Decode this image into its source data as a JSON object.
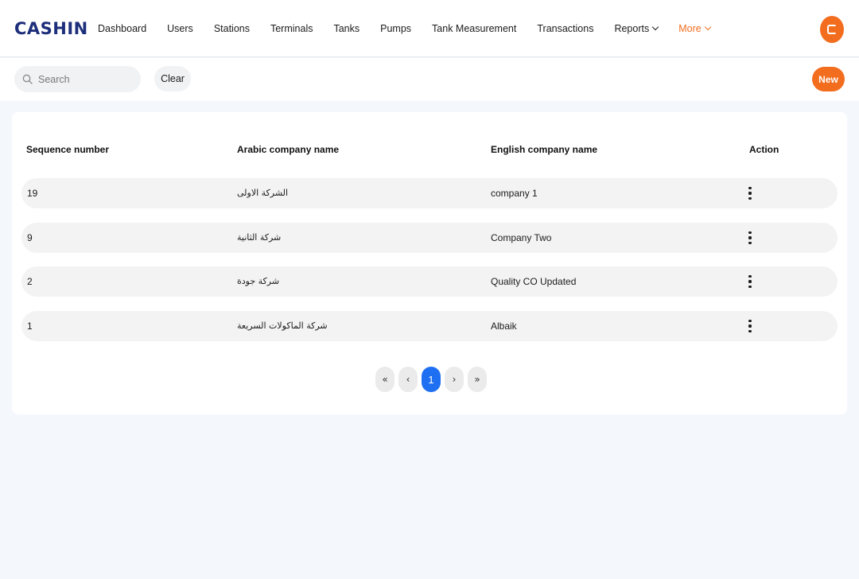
{
  "brand": {
    "logo_text": "CASHIN",
    "accent_color": "#f36d1e",
    "logo_color": "#1d2e7a"
  },
  "nav": {
    "items": [
      {
        "label": "Dashboard"
      },
      {
        "label": "Users"
      },
      {
        "label": "Stations"
      },
      {
        "label": "Terminals"
      },
      {
        "label": "Tanks"
      },
      {
        "label": "Pumps"
      },
      {
        "label": "Tank Measurement"
      },
      {
        "label": "Transactions"
      },
      {
        "label": "Reports",
        "icon": "chevron-down-icon"
      },
      {
        "label": "More",
        "icon": "chevron-down-icon",
        "color": "#f36d1e"
      }
    ]
  },
  "toolbar": {
    "search_placeholder": "Search",
    "clear_label": "Clear",
    "new_label": "New"
  },
  "table": {
    "headers": {
      "sequence": "Sequence number",
      "arabic": "Arabic company name",
      "english": "English company name",
      "action": "Action"
    },
    "rows": [
      {
        "sequence": "19",
        "arabic": "الشركة الاولى",
        "english": "company 1"
      },
      {
        "sequence": "9",
        "arabic": "شركة الثانية",
        "english": "Company Two"
      },
      {
        "sequence": "2",
        "arabic": "شركة جودة",
        "english": "Quality CO Updated"
      },
      {
        "sequence": "1",
        "arabic": "شركة الماكولات السريعة",
        "english": "Albaik"
      }
    ]
  },
  "pagination": {
    "first": "«",
    "prev": "‹",
    "current": "1",
    "next": "›",
    "last": "»",
    "active_color": "#1f6ff2"
  }
}
